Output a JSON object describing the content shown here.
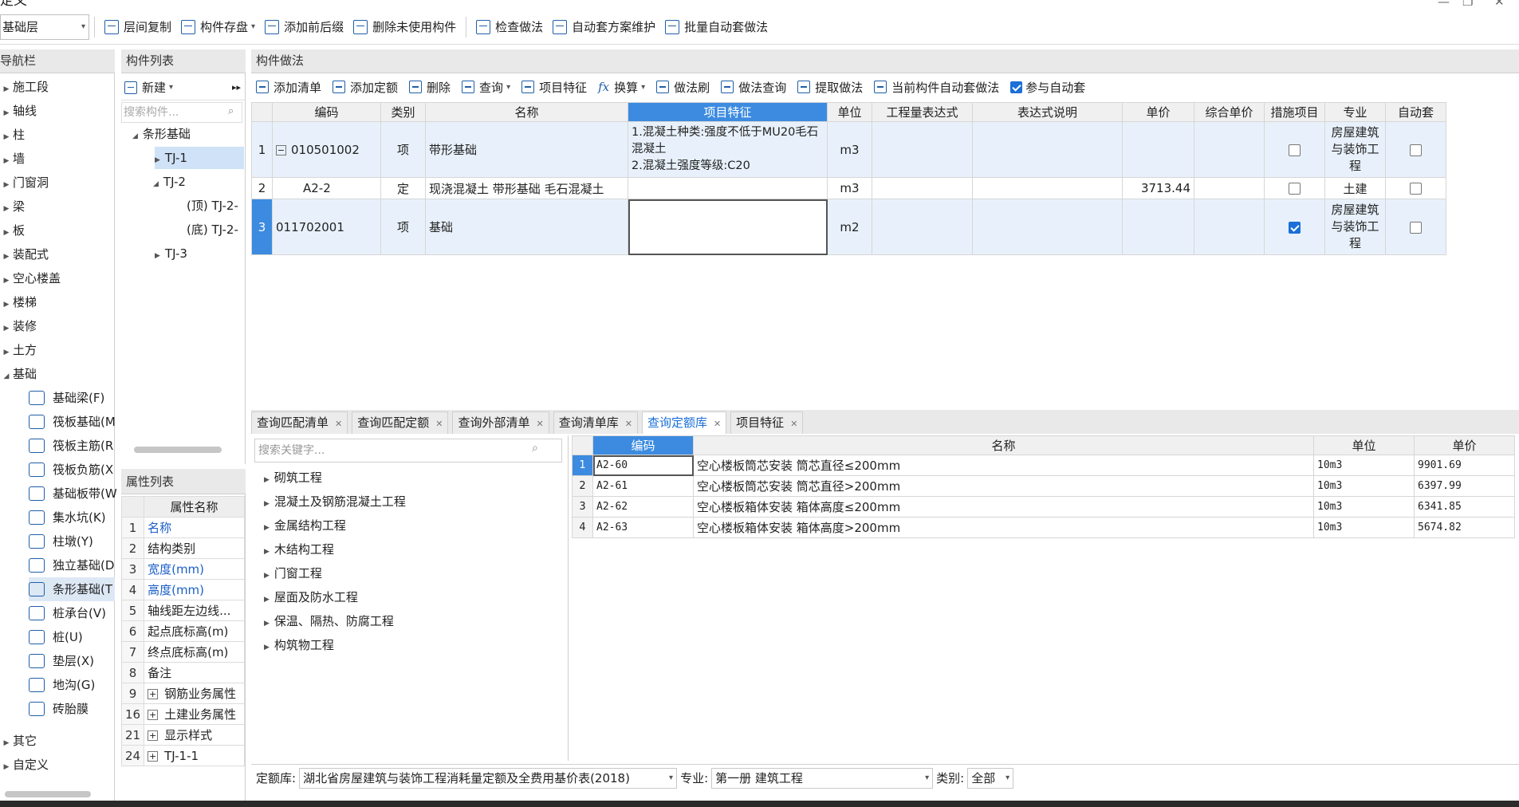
{
  "window": {
    "title": "定义"
  },
  "toolbar": {
    "floor": "基础层",
    "buttons": [
      "层间复制",
      "构件存盘",
      "添加前后缀",
      "删除未使用构件",
      "检查做法",
      "自动套方案维护",
      "批量自动套做法"
    ]
  },
  "nav": {
    "title": "导航栏",
    "items": [
      "施工段",
      "轴线",
      "柱",
      "墙",
      "门窗洞",
      "梁",
      "板",
      "装配式",
      "空心楼盖",
      "楼梯",
      "装修",
      "土方",
      "基础"
    ],
    "sub_items": [
      "基础梁(F)",
      "筏板基础(M",
      "筏板主筋(R",
      "筏板负筋(X",
      "基础板带(W",
      "集水坑(K)",
      "柱墩(Y)",
      "独立基础(D",
      "条形基础(T",
      "桩承台(V)",
      "桩(U)",
      "垫层(X)",
      "地沟(G)",
      "砖胎膜"
    ],
    "after": [
      "其它",
      "自定义"
    ]
  },
  "comp": {
    "title": "构件列表",
    "new_label": "新建",
    "search_placeholder": "搜索构件...",
    "tree": [
      "条形基础",
      "TJ-1",
      "TJ-2",
      "(顶) TJ-2-",
      "(底) TJ-2-",
      "TJ-3"
    ]
  },
  "props": {
    "title": "属性列表",
    "header": "属性名称",
    "rows": [
      {
        "n": "1",
        "name": "名称"
      },
      {
        "n": "2",
        "name": "结构类别"
      },
      {
        "n": "3",
        "name": "宽度(mm)"
      },
      {
        "n": "4",
        "name": "高度(mm)"
      },
      {
        "n": "5",
        "name": "轴线距左边线..."
      },
      {
        "n": "6",
        "name": "起点底标高(m)"
      },
      {
        "n": "7",
        "name": "终点底标高(m)"
      },
      {
        "n": "8",
        "name": "备注"
      },
      {
        "n": "9",
        "name": "钢筋业务属性"
      },
      {
        "n": "16",
        "name": "土建业务属性"
      },
      {
        "n": "21",
        "name": "显示样式"
      },
      {
        "n": "24",
        "name": "TJ-1-1"
      }
    ]
  },
  "method": {
    "title": "构件做法",
    "toolbar": [
      "添加清单",
      "添加定额",
      "删除",
      "查询",
      "项目特征",
      "换算",
      "做法刷",
      "做法查询",
      "提取做法",
      "当前构件自动套做法",
      "参与自动套"
    ],
    "columns": [
      "编码",
      "类别",
      "名称",
      "项目特征",
      "单位",
      "工程量表达式",
      "表达式说明",
      "单价",
      "综合单价",
      "措施项目",
      "专业",
      "自动套"
    ],
    "rows": [
      {
        "n": "1",
        "code": "010501002",
        "type": "项",
        "name": "带形基础",
        "feature": "1.混凝土种类:强度不低于MU20毛石混凝土\n2.混凝土强度等级:C20",
        "unit": "m3",
        "expr": "",
        "desc": "",
        "price": "",
        "total": "",
        "measure": false,
        "major": "房屋建筑与装饰工程",
        "auto": false
      },
      {
        "n": "2",
        "code": "A2-2",
        "type": "定",
        "name": "现浇混凝土 带形基础 毛石混凝土",
        "feature": "",
        "unit": "m3",
        "expr": "",
        "desc": "",
        "price": "3713.44",
        "total": "",
        "measure": false,
        "major": "土建",
        "auto": false
      },
      {
        "n": "3",
        "code": "011702001",
        "type": "项",
        "name": "基础",
        "feature": "",
        "unit": "m2",
        "expr": "",
        "desc": "",
        "price": "",
        "total": "",
        "measure": true,
        "major": "房屋建筑与装饰工程",
        "auto": false
      }
    ]
  },
  "tabs": [
    "查询匹配清单",
    "查询匹配定额",
    "查询外部清单",
    "查询清单库",
    "查询定额库",
    "项目特征"
  ],
  "lib": {
    "search_placeholder": "搜索关键字...",
    "categories": [
      "砌筑工程",
      "混凝土及钢筋混凝土工程",
      "金属结构工程",
      "木结构工程",
      "门窗工程",
      "屋面及防水工程",
      "保温、隔热、防腐工程",
      "构筑物工程"
    ],
    "columns": [
      "编码",
      "名称",
      "单位",
      "单价"
    ],
    "rows": [
      {
        "n": "1",
        "code": "A2-60",
        "name": "空心楼板筒芯安装 筒芯直径≤200mm",
        "unit": "10m3",
        "price": "9901.69"
      },
      {
        "n": "2",
        "code": "A2-61",
        "name": "空心楼板筒芯安装 筒芯直径>200mm",
        "unit": "10m3",
        "price": "6397.99"
      },
      {
        "n": "3",
        "code": "A2-62",
        "name": "空心楼板箱体安装 箱体高度≤200mm",
        "unit": "10m3",
        "price": "6341.85"
      },
      {
        "n": "4",
        "code": "A2-63",
        "name": "空心楼板箱体安装 箱体高度>200mm",
        "unit": "10m3",
        "price": "5674.82"
      }
    ]
  },
  "filter": {
    "lib_label": "定额库:",
    "lib_value": "湖北省房屋建筑与装饰工程消耗量定额及全费用基价表(2018)",
    "major_label": "专业:",
    "major_value": "第一册 建筑工程",
    "type_label": "类别:",
    "type_value": "全部"
  },
  "colors": {
    "accent": "#3c8be0",
    "icon": "#1f5fa8"
  }
}
